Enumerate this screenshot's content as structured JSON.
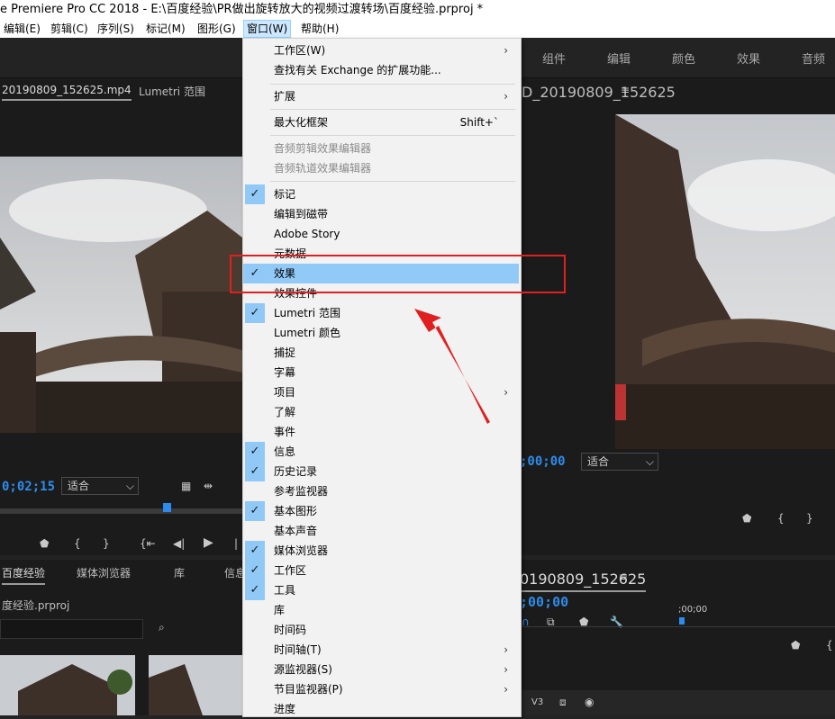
{
  "window": {
    "title": "e Premiere Pro CC 2018 - E:\\百度经验\\PR做出旋转放大的视频过渡转场\\百度经验.prproj *"
  },
  "menubar": [
    "编辑(E)",
    "剪辑(C)",
    "序列(S)",
    "标记(M)",
    "图形(G)",
    "窗口(W)",
    "帮助(H)"
  ],
  "workspaces": [
    "组件",
    "编辑",
    "颜色",
    "效果",
    "音频"
  ],
  "source_panel": {
    "tabs": [
      "20190809_152625.mp4",
      "Lumetri 范围"
    ],
    "timecode": "0;02;15",
    "fit": "适合"
  },
  "program_panel": {
    "title": "D_20190809_152625",
    "timecode": ";00;00",
    "fit": "适合"
  },
  "project_panel": {
    "tabs": [
      "百度经验",
      "媒体浏览器",
      "库",
      "信息"
    ],
    "path": "度经验.prproj"
  },
  "timeline_panel": {
    "title": "0190809_152625",
    "timecode": ";00;00",
    "ruler": ";00;00",
    "track": "V3"
  },
  "menu": {
    "items": [
      {
        "label": "工作区(W)",
        "submenu": true
      },
      {
        "label": "查找有关 Exchange 的扩展功能..."
      },
      {
        "label": "扩展",
        "submenu": true
      },
      {
        "label": "最大化框架",
        "shortcut": "Shift+`"
      },
      {
        "label": "音频剪辑效果编辑器",
        "disabled": true
      },
      {
        "label": "音频轨道效果编辑器",
        "disabled": true
      },
      {
        "label": "标记",
        "checked": true
      },
      {
        "label": "编辑到磁带"
      },
      {
        "label": "Adobe Story"
      },
      {
        "label": "元数据"
      },
      {
        "label": "效果",
        "checked": true,
        "highlighted": true
      },
      {
        "label": "效果控件"
      },
      {
        "label": "Lumetri 范围",
        "checked": true
      },
      {
        "label": "Lumetri 颜色"
      },
      {
        "label": "捕捉"
      },
      {
        "label": "字幕"
      },
      {
        "label": "项目",
        "submenu": true
      },
      {
        "label": "了解"
      },
      {
        "label": "事件"
      },
      {
        "label": "信息",
        "checked": true
      },
      {
        "label": "历史记录",
        "checked": true
      },
      {
        "label": "参考监视器"
      },
      {
        "label": "基本图形",
        "checked": true
      },
      {
        "label": "基本声音"
      },
      {
        "label": "媒体浏览器",
        "checked": true
      },
      {
        "label": "工作区",
        "checked": true
      },
      {
        "label": "工具",
        "checked": true
      },
      {
        "label": "库"
      },
      {
        "label": "时间码"
      },
      {
        "label": "时间轴(T)",
        "submenu": true
      },
      {
        "label": "源监视器(S)",
        "submenu": true
      },
      {
        "label": "节目监视器(P)",
        "submenu": true
      },
      {
        "label": "进度"
      }
    ]
  },
  "icons": {
    "check": "checkmark-icon",
    "arrow": "submenu-arrow-icon"
  },
  "colors": {
    "accent": "#2d8ceb",
    "highlight": "#91c9f7",
    "annotation": "#e02020"
  }
}
